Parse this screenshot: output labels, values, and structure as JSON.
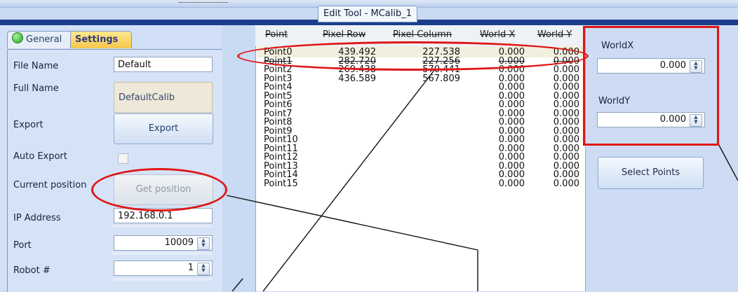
{
  "window": {
    "title": "Edit Tool - MCalib_1"
  },
  "tabs": [
    {
      "label": "General"
    },
    {
      "label": "Settings"
    }
  ],
  "settings": {
    "file_name": {
      "label": "File Name",
      "value": "Default"
    },
    "full_name": {
      "label": "Full Name",
      "value": "DefaultCalib"
    },
    "export": {
      "label": "Export",
      "button": "Export"
    },
    "auto_export": {
      "label": "Auto Export",
      "checked": false
    },
    "current_position": {
      "label": "Current position",
      "button": "Get position"
    },
    "ip_address": {
      "label": "IP Address",
      "value": "192.168.0.1"
    },
    "port": {
      "label": "Port",
      "value": "10009"
    },
    "robot": {
      "label": "Robot #",
      "value": "1"
    }
  },
  "grid": {
    "columns": [
      "Point",
      "Pixel Row",
      "Pixel Column",
      "World X",
      "World Y"
    ],
    "rows": [
      [
        "Point0",
        "439.492",
        "227.538",
        "0.000",
        "0.000"
      ],
      [
        "Point1",
        "282.720",
        "227.256",
        "0.000",
        "0.000"
      ],
      [
        "Point2",
        "269.438",
        "570.441",
        "0.000",
        "0.000"
      ],
      [
        "Point3",
        "436.589",
        "567.809",
        "0.000",
        "0.000"
      ],
      [
        "Point4",
        "",
        "",
        "0.000",
        "0.000"
      ],
      [
        "Point5",
        "",
        "",
        "0.000",
        "0.000"
      ],
      [
        "Point6",
        "",
        "",
        "0.000",
        "0.000"
      ],
      [
        "Point7",
        "",
        "",
        "0.000",
        "0.000"
      ],
      [
        "Point8",
        "",
        "",
        "0.000",
        "0.000"
      ],
      [
        "Point9",
        "",
        "",
        "0.000",
        "0.000"
      ],
      [
        "Point10",
        "",
        "",
        "0.000",
        "0.000"
      ],
      [
        "Point11",
        "",
        "",
        "0.000",
        "0.000"
      ],
      [
        "Point12",
        "",
        "",
        "0.000",
        "0.000"
      ],
      [
        "Point13",
        "",
        "",
        "0.000",
        "0.000"
      ],
      [
        "Point14",
        "",
        "",
        "0.000",
        "0.000"
      ],
      [
        "Point15",
        "",
        "",
        "0.000",
        "0.000"
      ]
    ]
  },
  "world": {
    "x": {
      "label": "WorldX",
      "value": "0.000"
    },
    "y": {
      "label": "WorldY",
      "value": "0.000"
    },
    "select_button": "Select Points"
  },
  "icons": {
    "status": "green-status-dot-icon",
    "spinner": "up-down-spinner-icon",
    "checkbox": "checkbox-unchecked-icon"
  },
  "colors": {
    "annotation": "#e01616",
    "selected_tab": "#f6c64b",
    "title_bar": "#1b3e8a"
  }
}
